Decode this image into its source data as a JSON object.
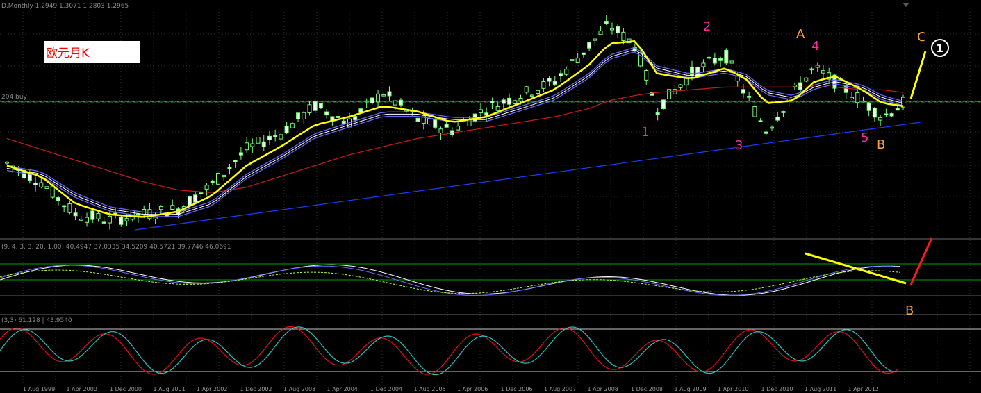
{
  "window": {
    "header_main": "D,Monthly  1.2949 1.3071 1.2803 1.2965",
    "price_line_label": "204 buy",
    "header_osc1": "(9, 4, 3, 3, 20, 1.00) 40.4947 37.0335 34.5209 40.5721 39.7746 46.0691",
    "header_osc2": "(3,3) 61.128 | 43.9540",
    "title": "欧元月K"
  },
  "x_axis_labels": [
    "1 Aug 1999",
    "1 Apr 2000",
    "1 Dec 2000",
    "1 Aug 2001",
    "1 Apr 2002",
    "1 Dec 2002",
    "1 Aug 2003",
    "1 Apr 2004",
    "1 Dec 2004",
    "1 Aug 2005",
    "1 Apr 2006",
    "1 Dec 2006",
    "1 Aug 2007",
    "1 Apr 2008",
    "1 Dec 2008",
    "1 Aug 2009",
    "1 Apr 2010",
    "1 Dec 2010",
    "1 Aug 2011",
    "1 Apr 2012"
  ],
  "annotations": {
    "wave_1": "1",
    "wave_2": "2",
    "wave_3": "3",
    "wave_4": "4",
    "wave_5": "5",
    "wave_A": "A",
    "wave_B": "B",
    "wave_C": "C",
    "circle_1": "1",
    "osc_B": "B"
  },
  "colors": {
    "background": "#000000",
    "grid": "#2a2a2a",
    "candle_up": "#7cff7c",
    "candle_body": "#e8ffe8",
    "ma_yellow": "#ffff00",
    "ma_blue": "#6666ff",
    "ma_white": "#ffffff",
    "ma_red": "#cc1b1b",
    "trendline": "#1e3cff",
    "magenta": "#ff2aa0",
    "orange": "#ffa040",
    "osc_green": "#00b000",
    "stoch_red": "#e01010",
    "stoch_cyan": "#30c0c0"
  },
  "chart_data": {
    "type": "line",
    "x": [
      1999.5,
      2000.0,
      2000.5,
      2001.0,
      2001.5,
      2002.0,
      2002.5,
      2003.0,
      2003.5,
      2004.0,
      2004.5,
      2005.0,
      2005.5,
      2006.0,
      2006.5,
      2007.0,
      2007.5,
      2008.0,
      2008.3,
      2008.7,
      2009.0,
      2009.5,
      2010.0,
      2010.3,
      2010.6,
      2011.0,
      2011.3,
      2011.6,
      2012.0,
      2012.3,
      2012.6
    ],
    "series": [
      {
        "values": [
          1.07,
          1.0,
          0.88,
          0.86,
          0.88,
          0.9,
          0.99,
          1.12,
          1.18,
          1.28,
          1.22,
          1.33,
          1.23,
          1.19,
          1.27,
          1.32,
          1.37,
          1.5,
          1.58,
          1.5,
          1.27,
          1.4,
          1.47,
          1.32,
          1.19,
          1.33,
          1.42,
          1.37,
          1.3,
          1.24,
          1.29
        ]
      },
      {
        "values": [
          1.06,
          1.02,
          0.92,
          0.88,
          0.87,
          0.89,
          0.95,
          1.06,
          1.13,
          1.21,
          1.24,
          1.28,
          1.26,
          1.22,
          1.24,
          1.29,
          1.34,
          1.43,
          1.51,
          1.52,
          1.4,
          1.38,
          1.42,
          1.38,
          1.29,
          1.3,
          1.37,
          1.39,
          1.34,
          1.29,
          1.28
        ]
      },
      {
        "values": [
          1.05,
          1.03,
          0.95,
          0.9,
          0.88,
          0.88,
          0.92,
          1.02,
          1.09,
          1.17,
          1.21,
          1.25,
          1.25,
          1.23,
          1.23,
          1.27,
          1.31,
          1.39,
          1.46,
          1.49,
          1.42,
          1.39,
          1.41,
          1.39,
          1.33,
          1.31,
          1.35,
          1.37,
          1.35,
          1.31,
          1.29
        ]
      },
      {
        "values": [
          1.16,
          1.12,
          1.08,
          1.04,
          1.0,
          0.97,
          0.96,
          0.98,
          1.02,
          1.06,
          1.1,
          1.13,
          1.16,
          1.18,
          1.2,
          1.22,
          1.24,
          1.27,
          1.3,
          1.32,
          1.33,
          1.34,
          1.35,
          1.35,
          1.35,
          1.35,
          1.35,
          1.35,
          1.34,
          1.34,
          1.33
        ]
      }
    ]
  }
}
